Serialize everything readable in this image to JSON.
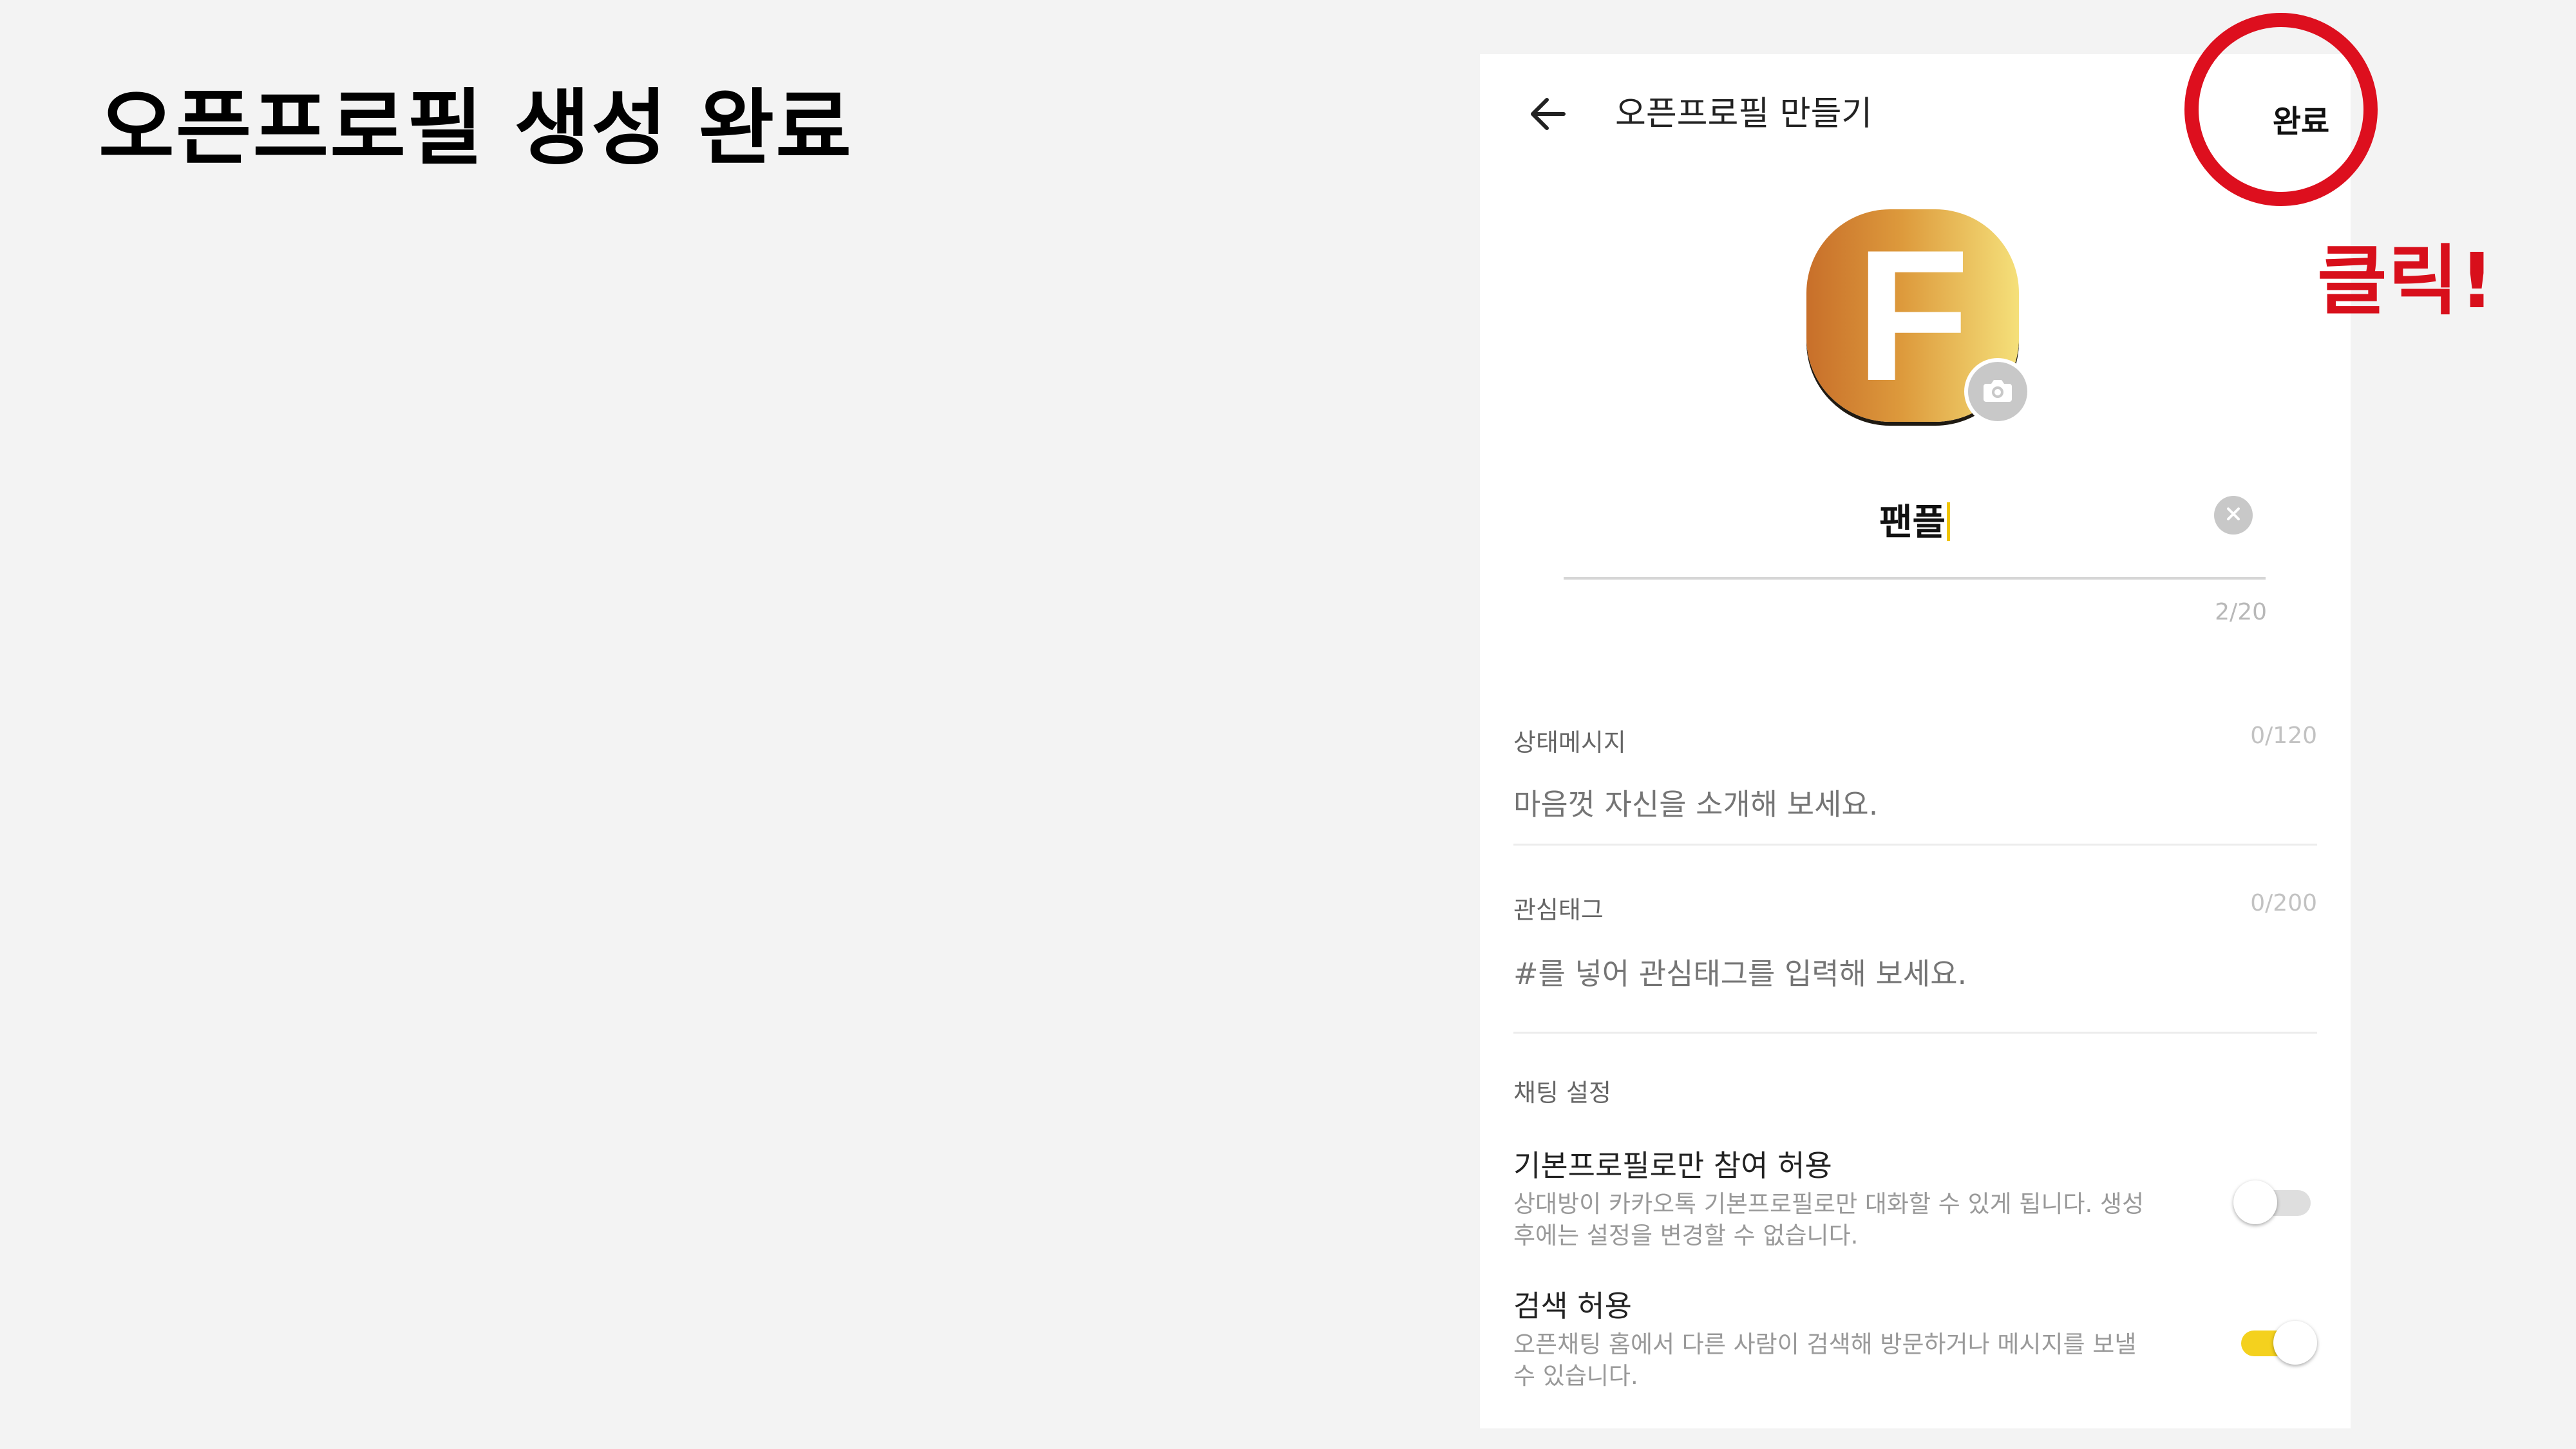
{
  "slide": {
    "title": "오픈프로필 생성 완료",
    "callout": "클릭!"
  },
  "header": {
    "title": "오픈프로필 만들기",
    "done_label": "완료"
  },
  "profile": {
    "avatar_letter": "F",
    "name": "팬플",
    "name_counter": "2/20"
  },
  "status_message": {
    "label": "상태메시지",
    "count": "0/120",
    "placeholder": "마음껏 자신을 소개해 보세요."
  },
  "interest_tags": {
    "label": "관심태그",
    "count": "0/200",
    "placeholder": "#를 넣어 관심태그를 입력해 보세요."
  },
  "chat_settings": {
    "label": "채팅 설정",
    "items": [
      {
        "title": "기본프로필로만 참여 허용",
        "desc": "상대방이 카카오톡 기본프로필로만 대화할 수 있게 됩니다. 생성 후에는 설정을 변경할 수 없습니다.",
        "enabled": false
      },
      {
        "title": "검색 허용",
        "desc": "오픈채팅 홈에서 다른 사람이 검색해 방문하거나 메시지를 보낼 수 있습니다.",
        "enabled": true
      }
    ]
  },
  "colors": {
    "background": "#f3f3f3",
    "highlight": "#dd0f1e",
    "toggle_on": "#f4d11e",
    "caret": "#f0c400"
  }
}
